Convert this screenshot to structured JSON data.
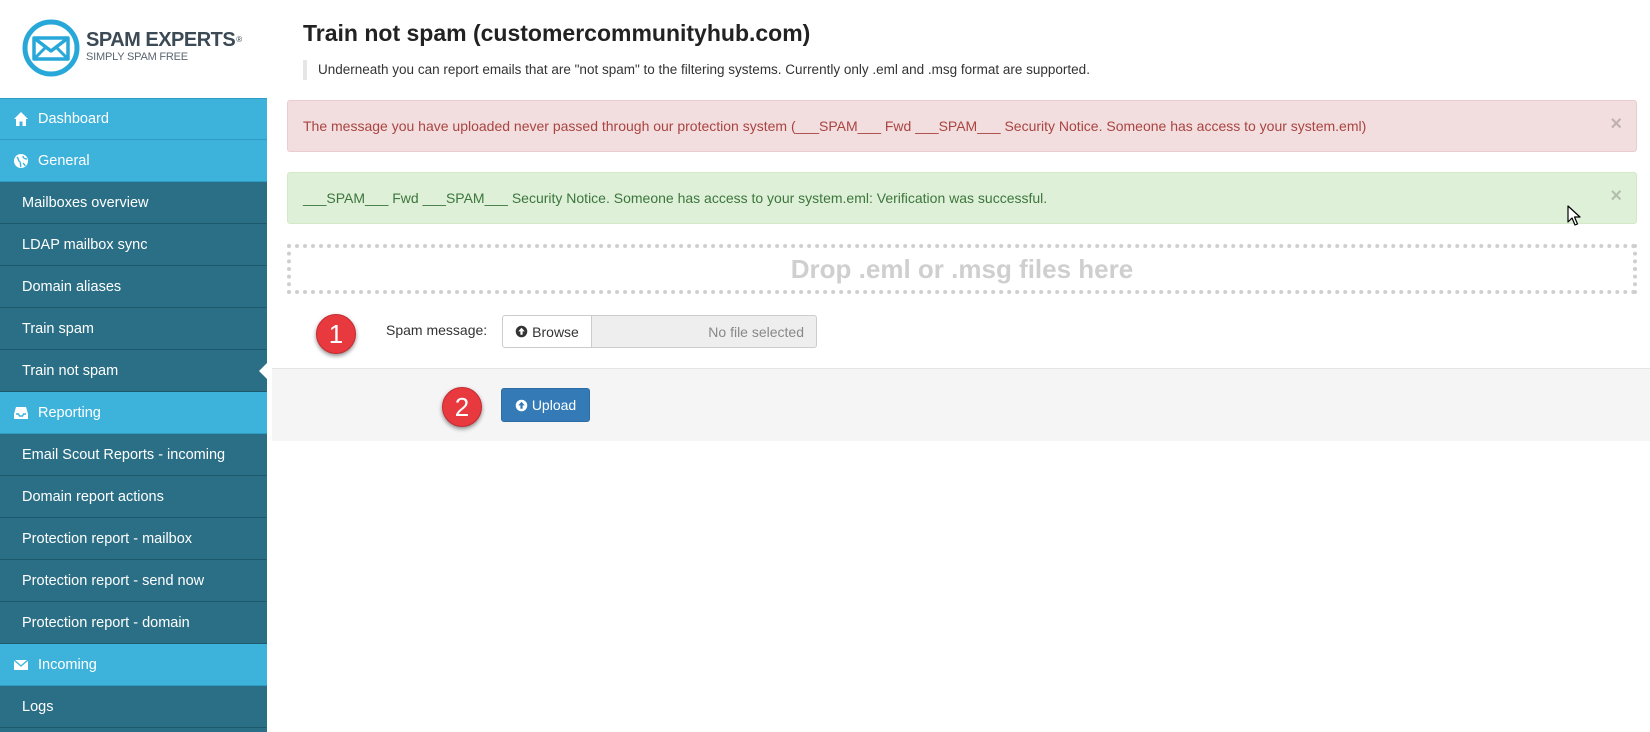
{
  "brand": {
    "name": "SPAM EXPERTS",
    "registered": "®",
    "tagline": "SIMPLY SPAM FREE",
    "color": "#27a8d8"
  },
  "sidebar": {
    "items": [
      {
        "label": "Dashboard",
        "type": "section",
        "icon": "home-icon"
      },
      {
        "label": "General",
        "type": "section",
        "icon": "globe-icon"
      },
      {
        "label": "Mailboxes overview",
        "type": "sub"
      },
      {
        "label": "LDAP mailbox sync",
        "type": "sub"
      },
      {
        "label": "Domain aliases",
        "type": "sub"
      },
      {
        "label": "Train spam",
        "type": "sub"
      },
      {
        "label": "Train not spam",
        "type": "sub",
        "active": true
      },
      {
        "label": "Reporting",
        "type": "section",
        "icon": "inbox-icon"
      },
      {
        "label": "Email Scout Reports - incoming",
        "type": "sub"
      },
      {
        "label": "Domain report actions",
        "type": "sub"
      },
      {
        "label": "Protection report - mailbox",
        "type": "sub"
      },
      {
        "label": "Protection report - send now",
        "type": "sub"
      },
      {
        "label": "Protection report - domain",
        "type": "sub"
      },
      {
        "label": "Incoming",
        "type": "section",
        "icon": "envelope-icon"
      },
      {
        "label": "Logs",
        "type": "sub"
      }
    ]
  },
  "page": {
    "title": "Train not spam (customercommunityhub.com)",
    "description": "Underneath you can report emails that are \"not spam\" to the filtering systems. Currently only .eml and .msg format are supported."
  },
  "alerts": {
    "error": "The message you have uploaded never passed through our protection system (___SPAM___ Fwd ___SPAM___ Security Notice. Someone has access to your system.eml)",
    "success": "___SPAM___ Fwd ___SPAM___ Security Notice. Someone has access to your system.eml: Verification was successful.",
    "close_symbol": "×"
  },
  "dropzone": {
    "text": "Drop .eml or .msg files here"
  },
  "form": {
    "step1": "1",
    "step2": "2",
    "field_label": "Spam message:",
    "browse_label": "Browse",
    "file_placeholder": "No file selected",
    "upload_label": "Upload"
  }
}
